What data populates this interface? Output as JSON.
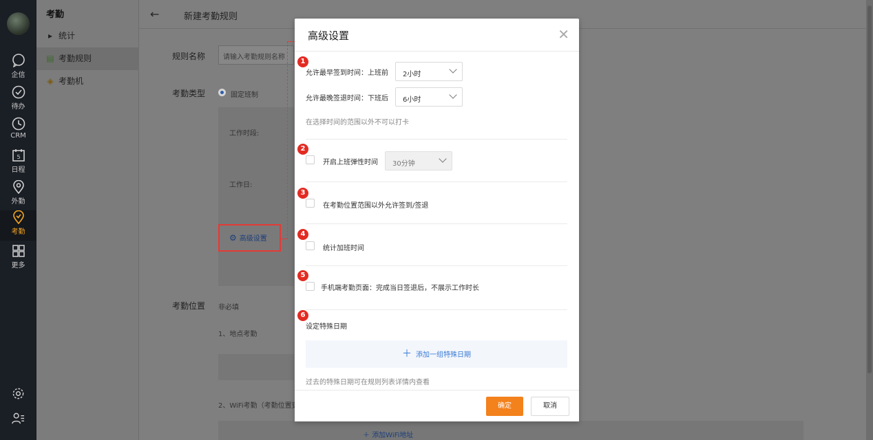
{
  "rail": {
    "items": [
      {
        "label": "企信",
        "icon": "chat-icon"
      },
      {
        "label": "待办",
        "icon": "check-circle-icon"
      },
      {
        "label": "CRM",
        "icon": "clock-icon"
      },
      {
        "label": "日程",
        "icon": "calendar-icon",
        "badge": "5"
      },
      {
        "label": "外勤",
        "icon": "location-pin-icon"
      },
      {
        "label": "考勤",
        "icon": "attendance-icon"
      },
      {
        "label": "更多",
        "icon": "grid-icon"
      }
    ]
  },
  "subnav": {
    "title": "考勤",
    "items": [
      {
        "label": "统计"
      },
      {
        "label": "考勤规则"
      },
      {
        "label": "考勤机"
      }
    ]
  },
  "main": {
    "back": "←",
    "title": "新建考勤规则",
    "rule_name_label": "规则名称",
    "rule_name_placeholder": "请输入考勤规则名称",
    "type_label": "考勤类型",
    "type_option": "固定班制",
    "work_period_label": "工作时段:",
    "work_day_label": "工作日:",
    "advanced_label": "高级设置",
    "location_label": "考勤位置",
    "location_hint": "非必填",
    "location_1": "1、地点考勤",
    "location_2": "2、WiFi考勤（考勤位置更",
    "add_wifi": "添加WiFi地址"
  },
  "modal": {
    "title": "高级设置",
    "close": "✕",
    "s1": {
      "badge": "1",
      "earliest_label": "允许最早签到时间：上班前",
      "earliest_value": "2小时",
      "latest_label": "允许最晚签退时间：下班后",
      "latest_value": "6小时",
      "hint": "在选择时间的范围以外不可以打卡"
    },
    "s2": {
      "badge": "2",
      "label": "开启上班弹性时间",
      "value": "30分钟"
    },
    "s3": {
      "badge": "3",
      "label": "在考勤位置范围以外允许签到/签退"
    },
    "s4": {
      "badge": "4",
      "label": "统计加班时间"
    },
    "s5": {
      "badge": "5",
      "label": "手机端考勤页面：完成当日签退后，不展示工作时长"
    },
    "s6": {
      "badge": "6",
      "label": "设定特殊日期",
      "add": "添加一组特殊日期",
      "hint": "过去的特殊日期可在规则列表详情内查看"
    },
    "ok": "确定",
    "cancel": "取消"
  },
  "colors": {
    "accent": "#f3811c",
    "badge": "#e32b22",
    "link": "#3a7bd5"
  }
}
